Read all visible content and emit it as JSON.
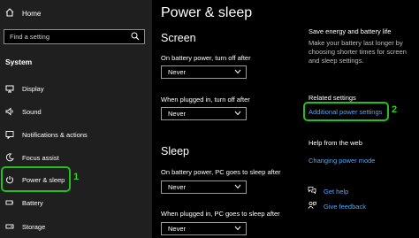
{
  "sidebar": {
    "home_label": "Home",
    "search_placeholder": "Find a setting",
    "section_label": "System",
    "items": [
      {
        "label": "Display",
        "icon": "display-icon"
      },
      {
        "label": "Sound",
        "icon": "sound-icon"
      },
      {
        "label": "Notifications & actions",
        "icon": "notifications-icon"
      },
      {
        "label": "Focus assist",
        "icon": "focus-assist-icon"
      },
      {
        "label": "Power & sleep",
        "icon": "power-icon",
        "active": true
      },
      {
        "label": "Battery",
        "icon": "battery-icon"
      },
      {
        "label": "Storage",
        "icon": "storage-icon"
      }
    ]
  },
  "callouts": {
    "one": "1",
    "two": "2"
  },
  "main": {
    "title": "Power & sleep",
    "screen_heading": "Screen",
    "screen_battery_label": "On battery power, turn off after",
    "screen_battery_value": "Never",
    "screen_plugged_label": "When plugged in, turn off after",
    "screen_plugged_value": "Never",
    "sleep_heading": "Sleep",
    "sleep_battery_label": "On battery power, PC goes to sleep after",
    "sleep_battery_value": "Never",
    "sleep_plugged_label": "When plugged in, PC goes to sleep after",
    "sleep_plugged_value": "Never"
  },
  "right": {
    "save_title": "Save energy and battery life",
    "save_desc": "Make your battery last longer by choosing shorter times for screen and sleep settings.",
    "related_heading": "Related settings",
    "additional_power_link": "Additional power settings",
    "help_heading": "Help from the web",
    "changing_power_link": "Changing power mode",
    "get_help": "Get help",
    "give_feedback": "Give feedback"
  },
  "colors": {
    "accent_link": "#4ea8ff",
    "highlight_green": "#22c11a"
  }
}
